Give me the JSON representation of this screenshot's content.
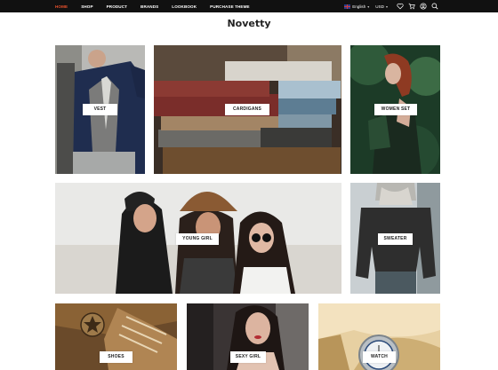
{
  "nav": {
    "items": [
      "HOME",
      "SHOP",
      "PRODUCT",
      "BRANDS",
      "LOOKBOOK",
      "PURCHASE THEME"
    ],
    "active": "HOME"
  },
  "header_tools": {
    "language": "English",
    "currency": "USD",
    "icons": [
      "heart-icon",
      "cart-icon",
      "user-icon",
      "search-icon"
    ]
  },
  "page": {
    "title": "Novetty"
  },
  "categories": [
    {
      "label": "VEST"
    },
    {
      "label": "CARDIGANS"
    },
    {
      "label": "WOMEN SET"
    },
    {
      "label": "YOUNG GIRL"
    },
    {
      "label": "SWEATER"
    },
    {
      "label": "SHOES"
    },
    {
      "label": "SEXY GIRL"
    },
    {
      "label": "WATCH"
    }
  ],
  "colors": {
    "topbar": "#111111",
    "active_nav": "#e8502b",
    "label_bg": "#ffffff"
  }
}
